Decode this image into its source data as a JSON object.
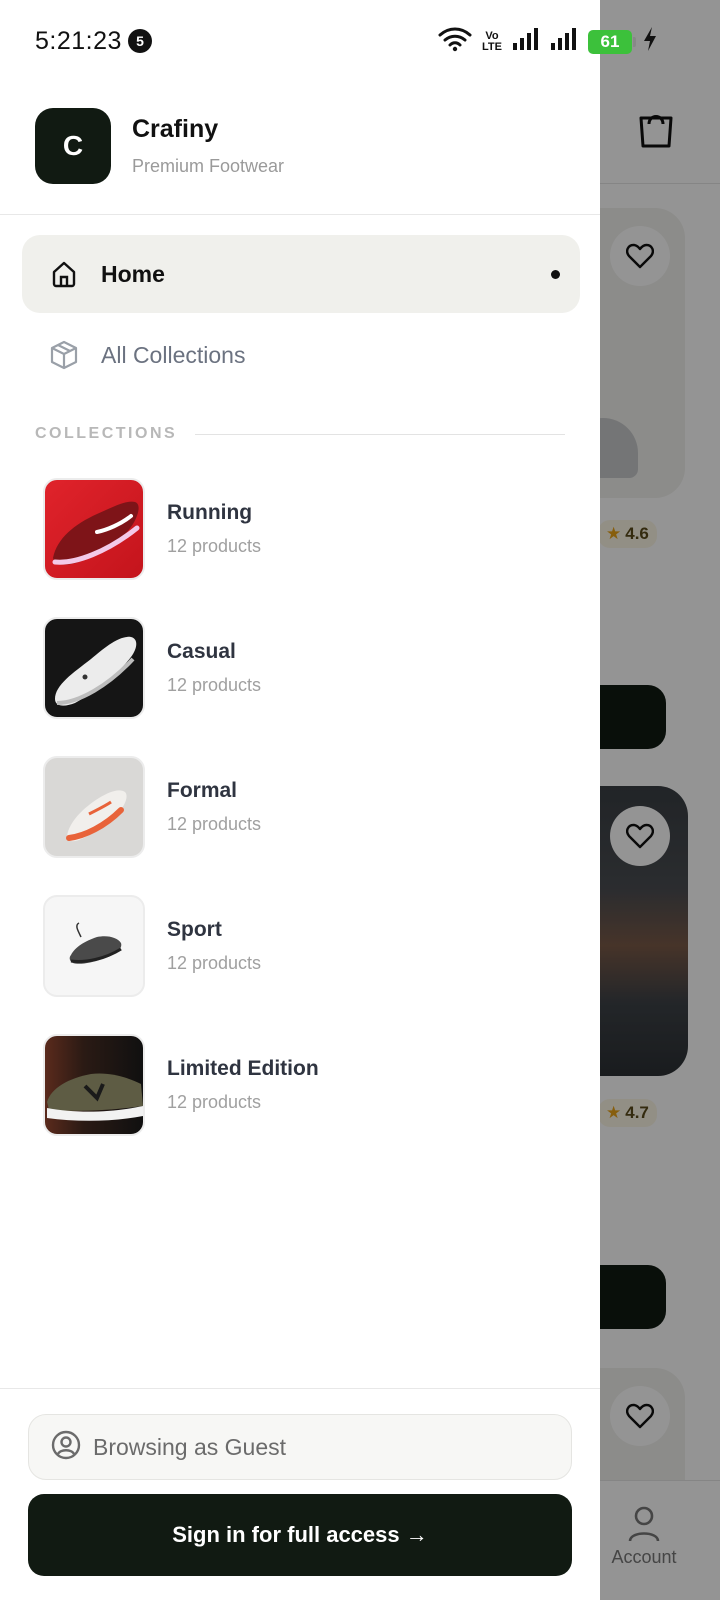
{
  "status_bar": {
    "time": "5:21:23",
    "notification_count": "5",
    "network_label_top": "Vo",
    "network_label_bottom": "LTE",
    "battery": "61"
  },
  "brand": {
    "logo_letter": "C",
    "name": "Crafiny",
    "tagline": "Premium Footwear"
  },
  "nav": {
    "home_label": "Home",
    "all_collections_label": "All Collections"
  },
  "collections_section": {
    "title": "COLLECTIONS",
    "items": [
      {
        "name": "Running",
        "count": "12 products"
      },
      {
        "name": "Casual",
        "count": "12 products"
      },
      {
        "name": "Formal",
        "count": "12 products"
      },
      {
        "name": "Sport",
        "count": "12 products"
      },
      {
        "name": "Limited Edition",
        "count": "12 products"
      }
    ]
  },
  "footer": {
    "guest_label": "Browsing as Guest",
    "signin_label": "Sign in for full access →"
  },
  "background": {
    "ratings": [
      "4.6",
      "4.7"
    ],
    "account_label": "Account"
  },
  "colors": {
    "accent_dark": "#111a12",
    "active_bg": "#f0f0ec",
    "battery_green": "#3cc13b"
  }
}
